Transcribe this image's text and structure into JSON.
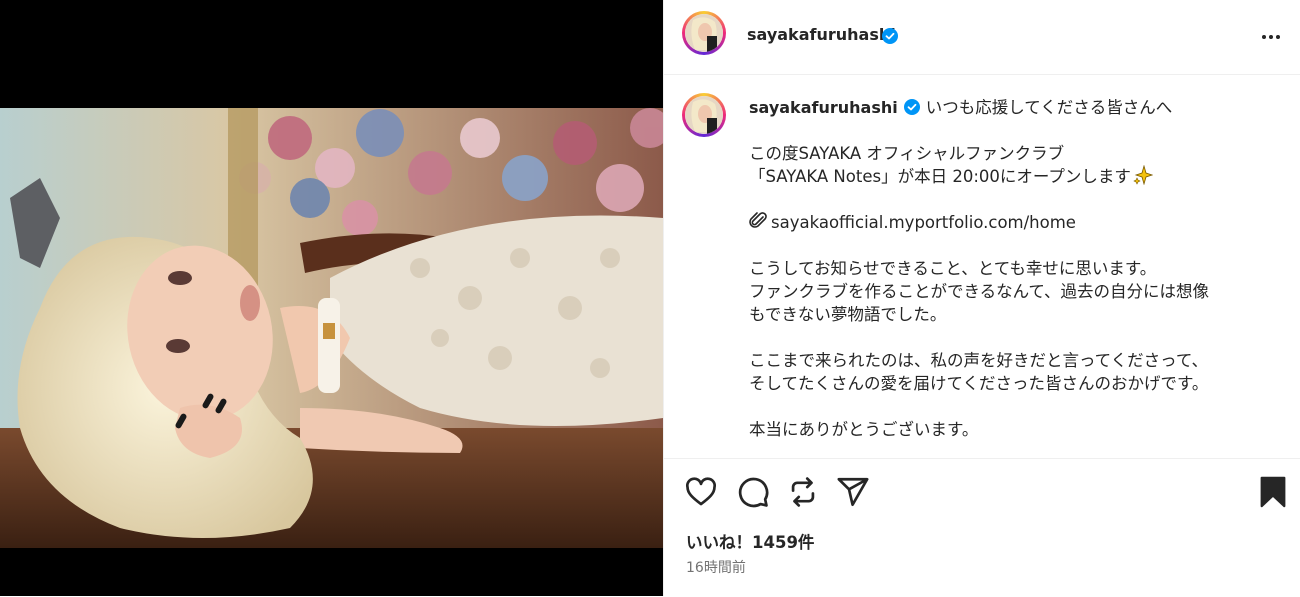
{
  "post": {
    "username": "sayakafuruhashi",
    "verified": true,
    "caption_lines": [
      "いつも応援してくださる皆さんへ",
      "",
      "この度SAYAKA オフィシャルファンクラブ",
      "「SAYAKA Notes」が本日 20:00にオープンします",
      "",
      "sayakaofficial.myportfolio.com/home",
      "",
      "こうしてお知らせできること、とても幸せに思います。",
      "ファンクラブを作ることができるなんて、過去の自分には想像",
      "もできない夢物語でした。",
      "",
      "ここまで来られたのは、私の声を好きだと言ってくださって、",
      "そしてたくさんの愛を届けてくださった皆さんのおかげです。",
      "",
      "本当にありがとうございます。"
    ],
    "likes": "いいね！1459件",
    "timestamp": "16時間前"
  },
  "icons": {
    "more": "more-options-icon",
    "like": "heart-icon",
    "comment": "comment-icon",
    "repost": "repost-icon",
    "share": "send-icon",
    "save": "bookmark-icon",
    "verified": "verified-badge-icon",
    "sparkle": "sparkle-emoji",
    "link": "paperclip-emoji"
  },
  "colors": {
    "verified_blue": "#0095f6",
    "text": "#262626",
    "secondary": "#737373",
    "border": "#efefef"
  }
}
